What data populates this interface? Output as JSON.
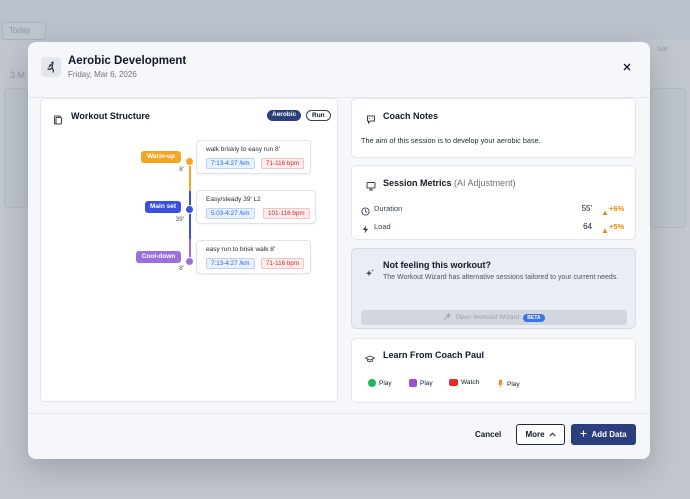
{
  "background": {
    "today_label": "Today",
    "sat_label": "Sat",
    "month_label": "3 M"
  },
  "header": {
    "title": "Aerobic Development",
    "date": "Friday, Mar 6, 2026",
    "header_icon": "runner-icon",
    "close_icon": "close-icon"
  },
  "workout_structure": {
    "title": "Workout Structure",
    "tags": [
      "Aerobic",
      "Run"
    ],
    "segments": [
      {
        "label": "Warm-up",
        "duration": "8'",
        "color": "#f5a524",
        "description": "walk briskly to easy run 8'",
        "pace": "7:13-4:27 /km",
        "hr": "71-116 bpm"
      },
      {
        "label": "Main set",
        "duration": "39'",
        "color": "#3b4fe0",
        "description": "Easy/steady 39' L2",
        "pace": "5:03-4:27 /km",
        "hr": "101-116 bpm"
      },
      {
        "label": "Cool-down",
        "duration": "8'",
        "color": "#9b6fe0",
        "description": "easy run to brisk walk 8'",
        "pace": "7:13-4:27 /km",
        "hr": "71-116 bpm"
      }
    ]
  },
  "coach_notes": {
    "title": "Coach Notes",
    "text": "The aim of this session is to develop your aerobic base."
  },
  "session_metrics": {
    "title": "Session Metrics",
    "subtitle": "(AI Adjustment)",
    "rows": [
      {
        "label": "Duration",
        "value": "55'",
        "delta": "+6%"
      },
      {
        "label": "Load",
        "value": "64",
        "delta": "+5%"
      }
    ]
  },
  "wizard": {
    "title": "Not feeling this workout?",
    "text": "The Workout Wizard has alternative sessions tailored to your current needs.",
    "button_label": "Open Workout Wizard",
    "badge": "BETA"
  },
  "learn": {
    "title": "Learn From Coach Paul",
    "items": [
      {
        "label": "Play",
        "icon": "spotify-icon",
        "color": "#1db954"
      },
      {
        "label": "Play",
        "icon": "podcast-icon",
        "color": "#9b4fd8"
      },
      {
        "label": "Watch",
        "icon": "youtube-icon",
        "color": "#e52d27"
      },
      {
        "label": "Play",
        "icon": "microphone-icon",
        "color": "#f08a3c"
      }
    ]
  },
  "footer": {
    "cancel_label": "Cancel",
    "more_label": "More",
    "add_label": "Add Data"
  }
}
